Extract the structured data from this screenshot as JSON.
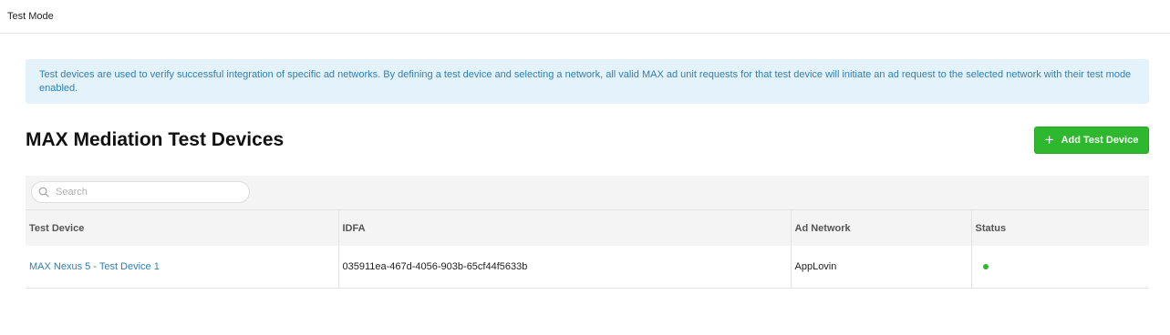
{
  "topbar": {
    "title": "Test Mode"
  },
  "info_banner": {
    "text": "Test devices are used to verify successful integration of specific ad networks. By defining a test device and selecting a network, all valid MAX ad unit requests for that test device will initiate an ad request to the selected network with their test mode enabled."
  },
  "page": {
    "title": "MAX Mediation Test Devices",
    "add_button_label": "Add Test Device"
  },
  "search": {
    "placeholder": "Search",
    "value": ""
  },
  "table": {
    "columns": [
      "Test Device",
      "IDFA",
      "Ad Network",
      "Status"
    ],
    "rows": [
      {
        "test_device": "MAX Nexus 5 - Test Device 1",
        "idfa": "035911ea-467d-4056-903b-65cf44f5633b",
        "ad_network": "AppLovin",
        "status": "active"
      }
    ]
  },
  "colors": {
    "accent_green": "#2eb82e",
    "link_blue": "#2f7fb3",
    "info_bg": "#e4f3fb"
  }
}
